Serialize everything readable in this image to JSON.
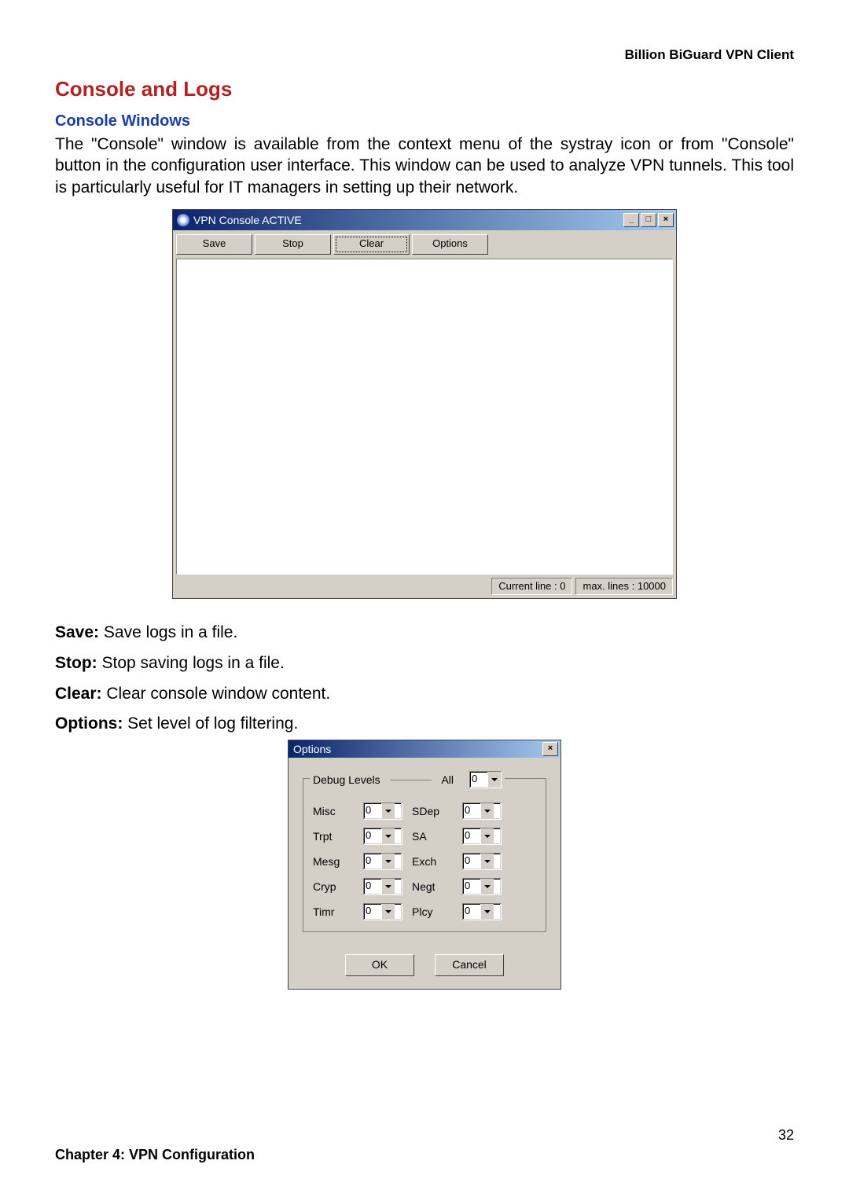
{
  "header": {
    "product": "Billion BiGuard VPN Client"
  },
  "section": {
    "title": "Console and Logs",
    "subtitle": "Console Windows",
    "paragraph": "The \"Console\" window is available from the context menu of the systray icon or from \"Console\" button in the configuration user interface. This window can be used to analyze VPN tunnels. This tool is particularly useful for IT managers in setting up their network."
  },
  "console_window": {
    "title": "VPN Console ACTIVE",
    "toolbar": {
      "save": "Save",
      "stop": "Stop",
      "clear": "Clear",
      "options": "Options"
    },
    "status": {
      "current": "Current line : 0",
      "max": "max. lines : 10000"
    }
  },
  "definitions": {
    "save_label": "Save:",
    "save_text": " Save logs in a file.",
    "stop_label": "Stop:",
    "stop_text": " Stop saving logs in a file.",
    "clear_label": "Clear:",
    "clear_text": " Clear console window content.",
    "options_label": "Options:",
    "options_text": " Set level of log filtering."
  },
  "options_dialog": {
    "title": "Options",
    "group_label": "Debug Levels",
    "all_label": "All",
    "all_value": "0",
    "rows": [
      {
        "l1": "Misc",
        "v1": "0",
        "l2": "SDep",
        "v2": "0"
      },
      {
        "l1": "Trpt",
        "v1": "0",
        "l2": "SA",
        "v2": "0"
      },
      {
        "l1": "Mesg",
        "v1": "0",
        "l2": "Exch",
        "v2": "0"
      },
      {
        "l1": "Cryp",
        "v1": "0",
        "l2": "Negt",
        "v2": "0"
      },
      {
        "l1": "Timr",
        "v1": "0",
        "l2": "Plcy",
        "v2": "0"
      }
    ],
    "ok": "OK",
    "cancel": "Cancel"
  },
  "footer": {
    "page": "32",
    "chapter": "Chapter 4: VPN Configuration"
  }
}
